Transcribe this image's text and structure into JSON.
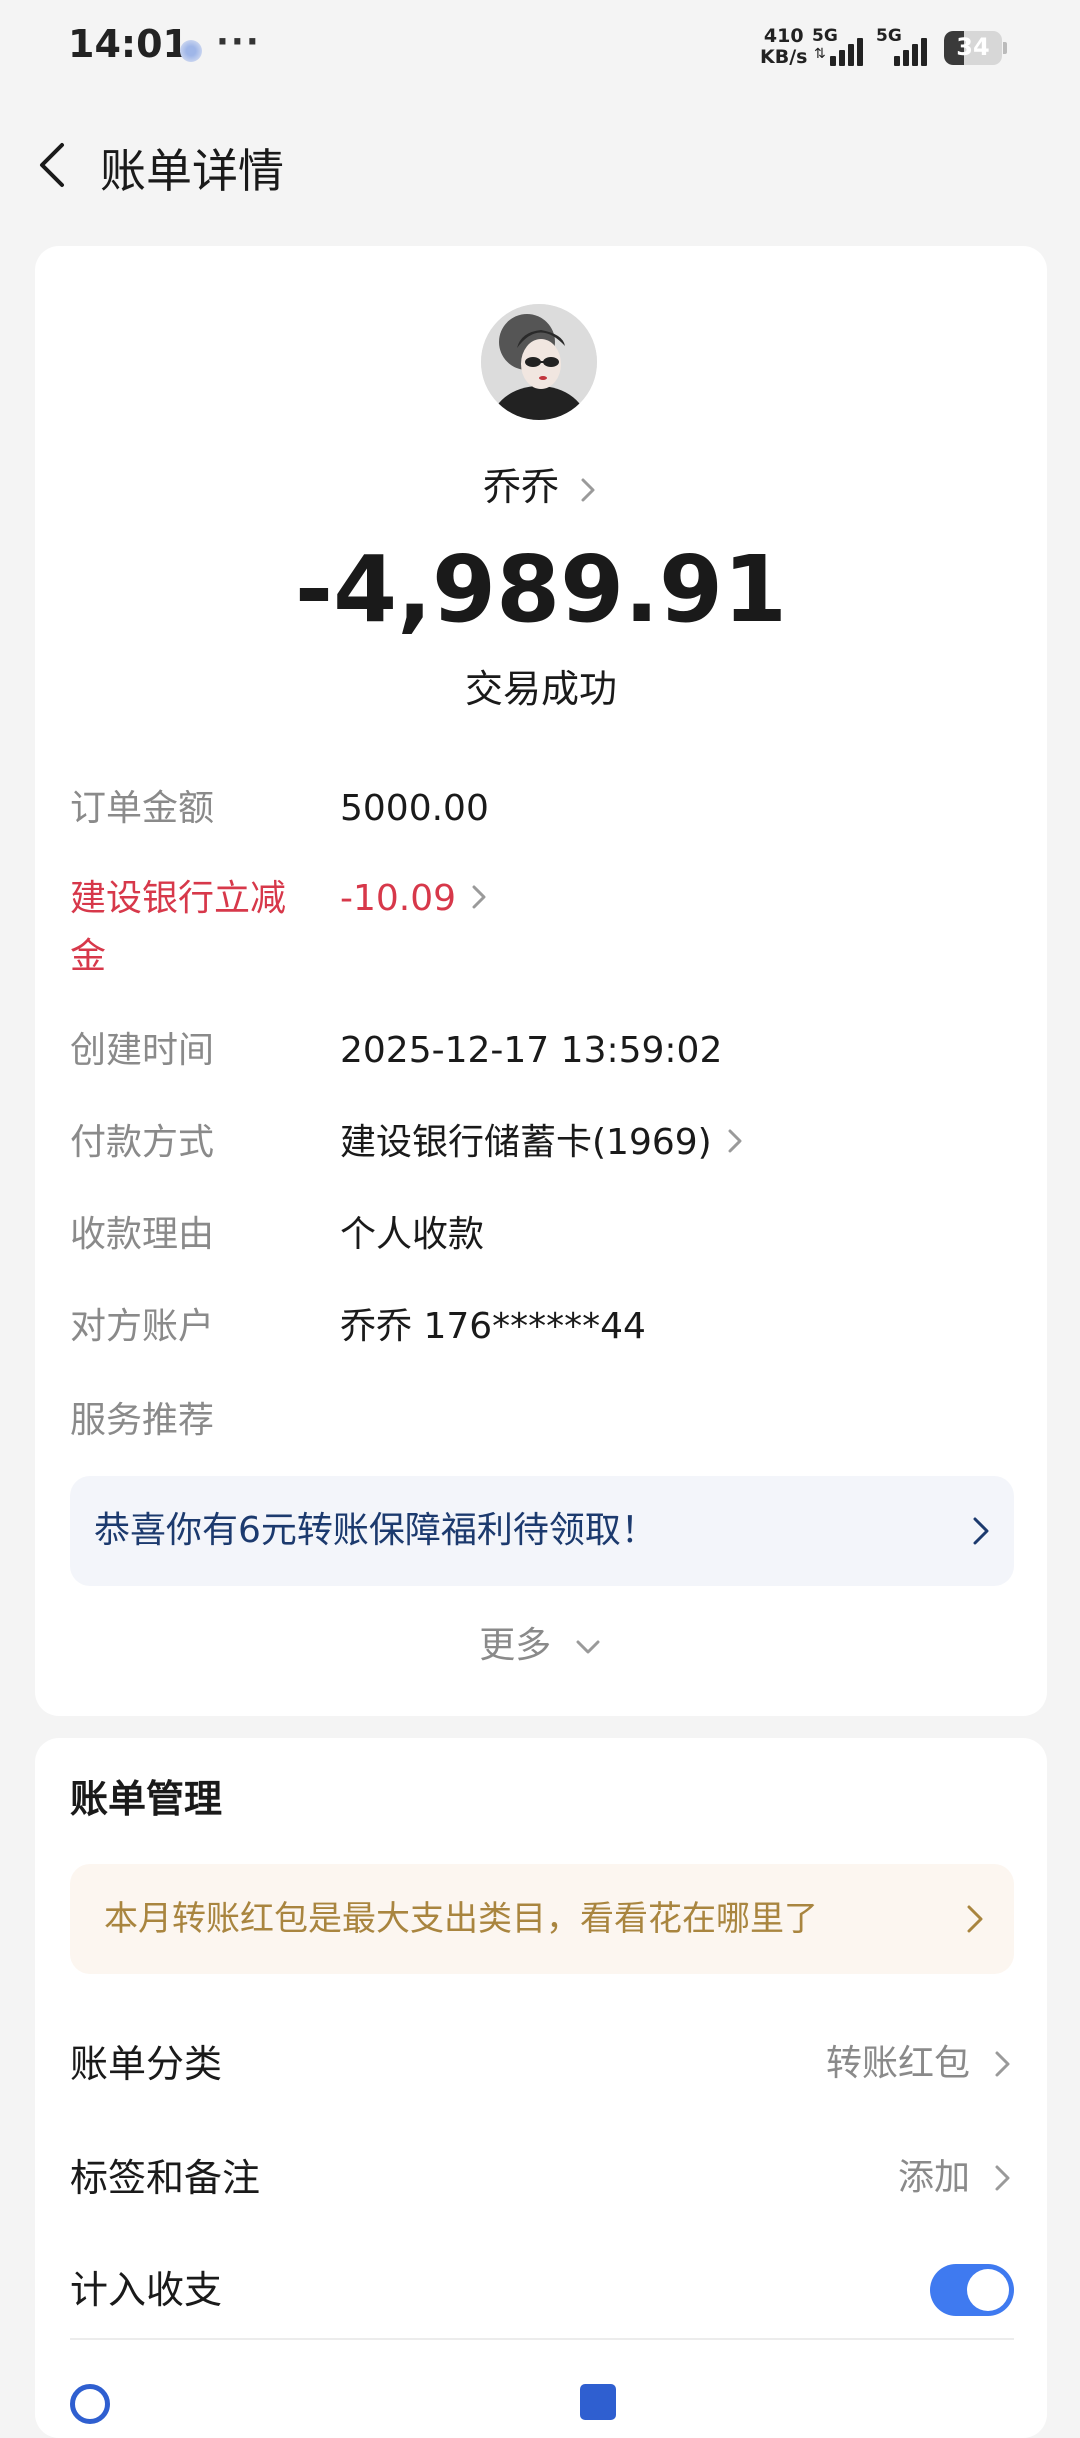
{
  "status_bar": {
    "time": "14:01",
    "more": "···",
    "net_speed_value": "410",
    "net_speed_unit": "KB/s",
    "signal_label_1": "5G",
    "signal_label_2": "5G",
    "battery_percent": "34",
    "battery_level": 0.34
  },
  "nav": {
    "title": "账单详情"
  },
  "transaction": {
    "payee": "乔乔",
    "amount": "-4,989.91",
    "status": "交易成功"
  },
  "details": [
    {
      "label": "订单金额",
      "value": "5000.00"
    },
    {
      "label": "建设银行立减金",
      "value": "-10.09"
    },
    {
      "label": "创建时间",
      "value": "2025-12-17 13:59:02"
    },
    {
      "label": "付款方式",
      "value": "建设银行储蓄卡(1969)"
    },
    {
      "label": "收款理由",
      "value": "个人收款"
    },
    {
      "label": "对方账户",
      "value": "乔乔 176******44"
    },
    {
      "label": "服务推荐",
      "value": ""
    }
  ],
  "promo": {
    "text": "恭喜你有6元转账保障福利待领取！"
  },
  "more": {
    "label": "更多"
  },
  "manage": {
    "title": "账单管理",
    "tip": "本月转账红包是最大支出类目，看看花在哪里了",
    "category_label": "账单分类",
    "category_value": "转账红包",
    "tags_label": "标签和备注",
    "tags_value": "添加",
    "count_label": "计入收支",
    "count_enabled": true
  },
  "colors": {
    "accent_blue": "#3f7af0",
    "discount_red": "#d7384a",
    "promo_text": "#1c3a6e",
    "tip_text": "#a9853f"
  }
}
